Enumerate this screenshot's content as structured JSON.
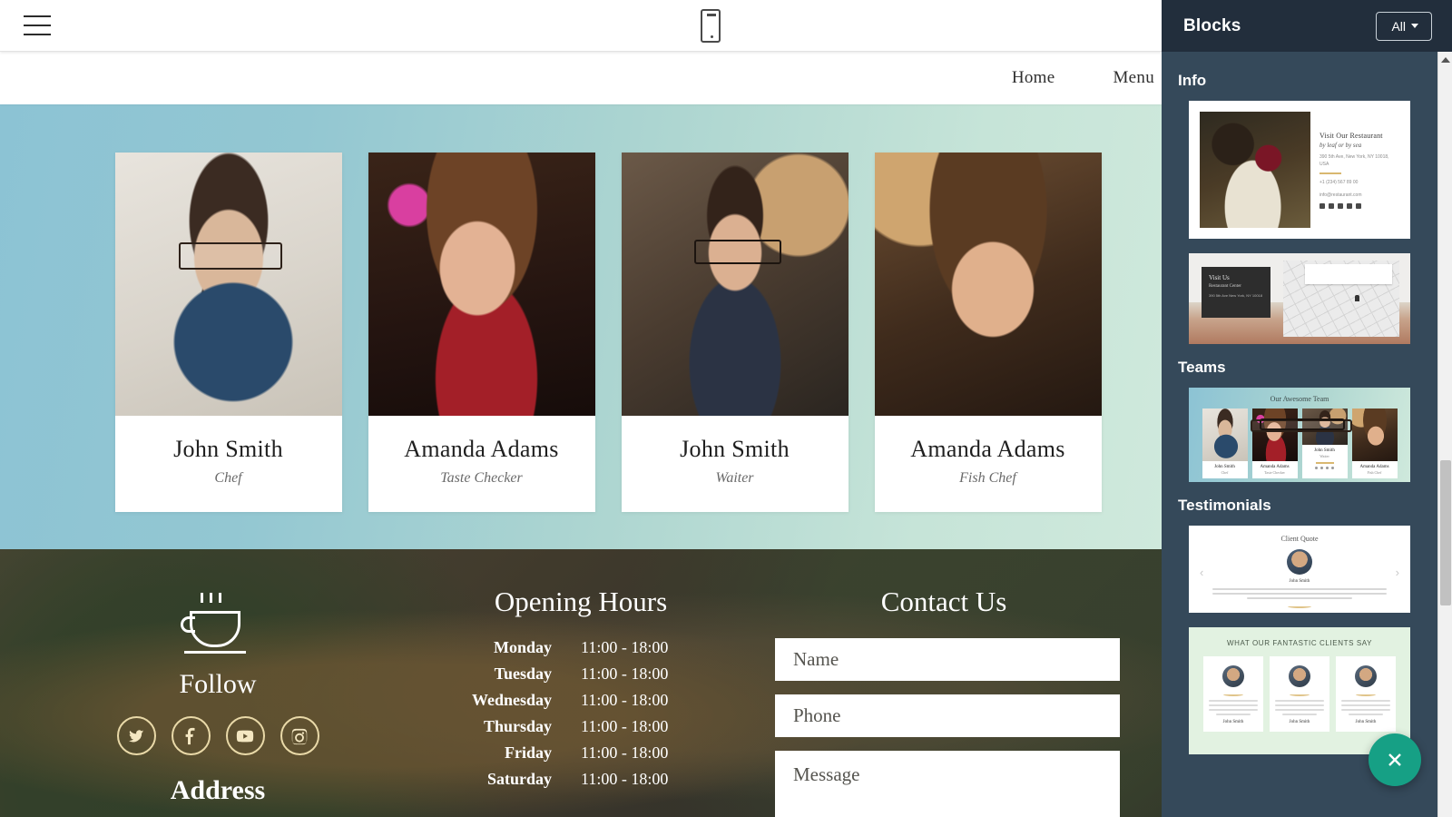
{
  "builder": {
    "toolbar": {
      "menu_icon": "hamburger-menu-icon",
      "device_icon": "mobile-preview-icon"
    },
    "panel": {
      "title": "Blocks",
      "filter_label": "All",
      "filter_caret": "chevron-down-icon",
      "close_label": "×",
      "groups": [
        {
          "name": "Info",
          "blocks": [
            {
              "id": "info-restaurant",
              "heading": "Visit Our Restaurant",
              "subheading": "by leaf or by sea",
              "address": "390 5th Ave, New York, NY 10018, USA",
              "phone": "+1 (234) 567 89 00",
              "email": "info@restaurant.com"
            },
            {
              "id": "info-map",
              "heading": "Visit Us",
              "subheading": "Restaurant Center",
              "address": "390 5th Ave New York, NY 10018"
            }
          ]
        },
        {
          "name": "Teams",
          "blocks": [
            {
              "id": "team-awesome",
              "heading": "Our Awesome Team",
              "members": [
                {
                  "name": "John Smith",
                  "role": "Chef"
                },
                {
                  "name": "Amanda Adams",
                  "role": "Taste Checker"
                },
                {
                  "name": "John Smith",
                  "role": "Waiter"
                },
                {
                  "name": "Amanda Adams",
                  "role": "Fish Chef"
                }
              ]
            }
          ]
        },
        {
          "name": "Testimonials",
          "blocks": [
            {
              "id": "testimonial-quote",
              "heading": "Client Quote",
              "author": "John Smith",
              "prev_icon": "chevron-left-icon",
              "next_icon": "chevron-right-icon"
            },
            {
              "id": "testimonial-clients",
              "heading": "WHAT OUR FANTASTIC CLIENTS SAY",
              "cards": [
                {
                  "author": "John Smith"
                },
                {
                  "author": "John Smith"
                },
                {
                  "author": "John Smith"
                }
              ]
            }
          ]
        }
      ]
    }
  },
  "site": {
    "nav": {
      "items": [
        {
          "label": "Home"
        },
        {
          "label": "Menu"
        }
      ]
    },
    "team_section": {
      "members": [
        {
          "name": "John Smith",
          "role": "Chef"
        },
        {
          "name": "Amanda Adams",
          "role": "Taste Checker"
        },
        {
          "name": "John Smith",
          "role": "Waiter"
        },
        {
          "name": "Amanda Adams",
          "role": "Fish Chef"
        }
      ]
    },
    "footer": {
      "logo_icon": "coffee-cup-logo-icon",
      "follow_title": "Follow",
      "address_title": "Address",
      "socials": [
        {
          "name": "twitter-icon"
        },
        {
          "name": "facebook-icon"
        },
        {
          "name": "youtube-icon"
        },
        {
          "name": "instagram-icon"
        }
      ],
      "hours_title": "Opening Hours",
      "hours": [
        {
          "day": "Monday",
          "time": "11:00 - 18:00"
        },
        {
          "day": "Tuesday",
          "time": "11:00 - 18:00"
        },
        {
          "day": "Wednesday",
          "time": "11:00 - 18:00"
        },
        {
          "day": "Thursday",
          "time": "11:00 - 18:00"
        },
        {
          "day": "Friday",
          "time": "11:00 - 18:00"
        },
        {
          "day": "Saturday",
          "time": "11:00 - 18:00"
        }
      ],
      "contact_title": "Contact Us",
      "fields": [
        {
          "placeholder": "Name"
        },
        {
          "placeholder": "Phone"
        },
        {
          "placeholder": "Message"
        }
      ]
    }
  },
  "colors": {
    "panel_bg": "#35495a",
    "panel_header_bg": "#222e3c",
    "accent_teal": "#16a085",
    "gradient_start": "#8cc3d4",
    "gradient_end": "#cfe9dc",
    "gold": "#e9d9a8"
  }
}
